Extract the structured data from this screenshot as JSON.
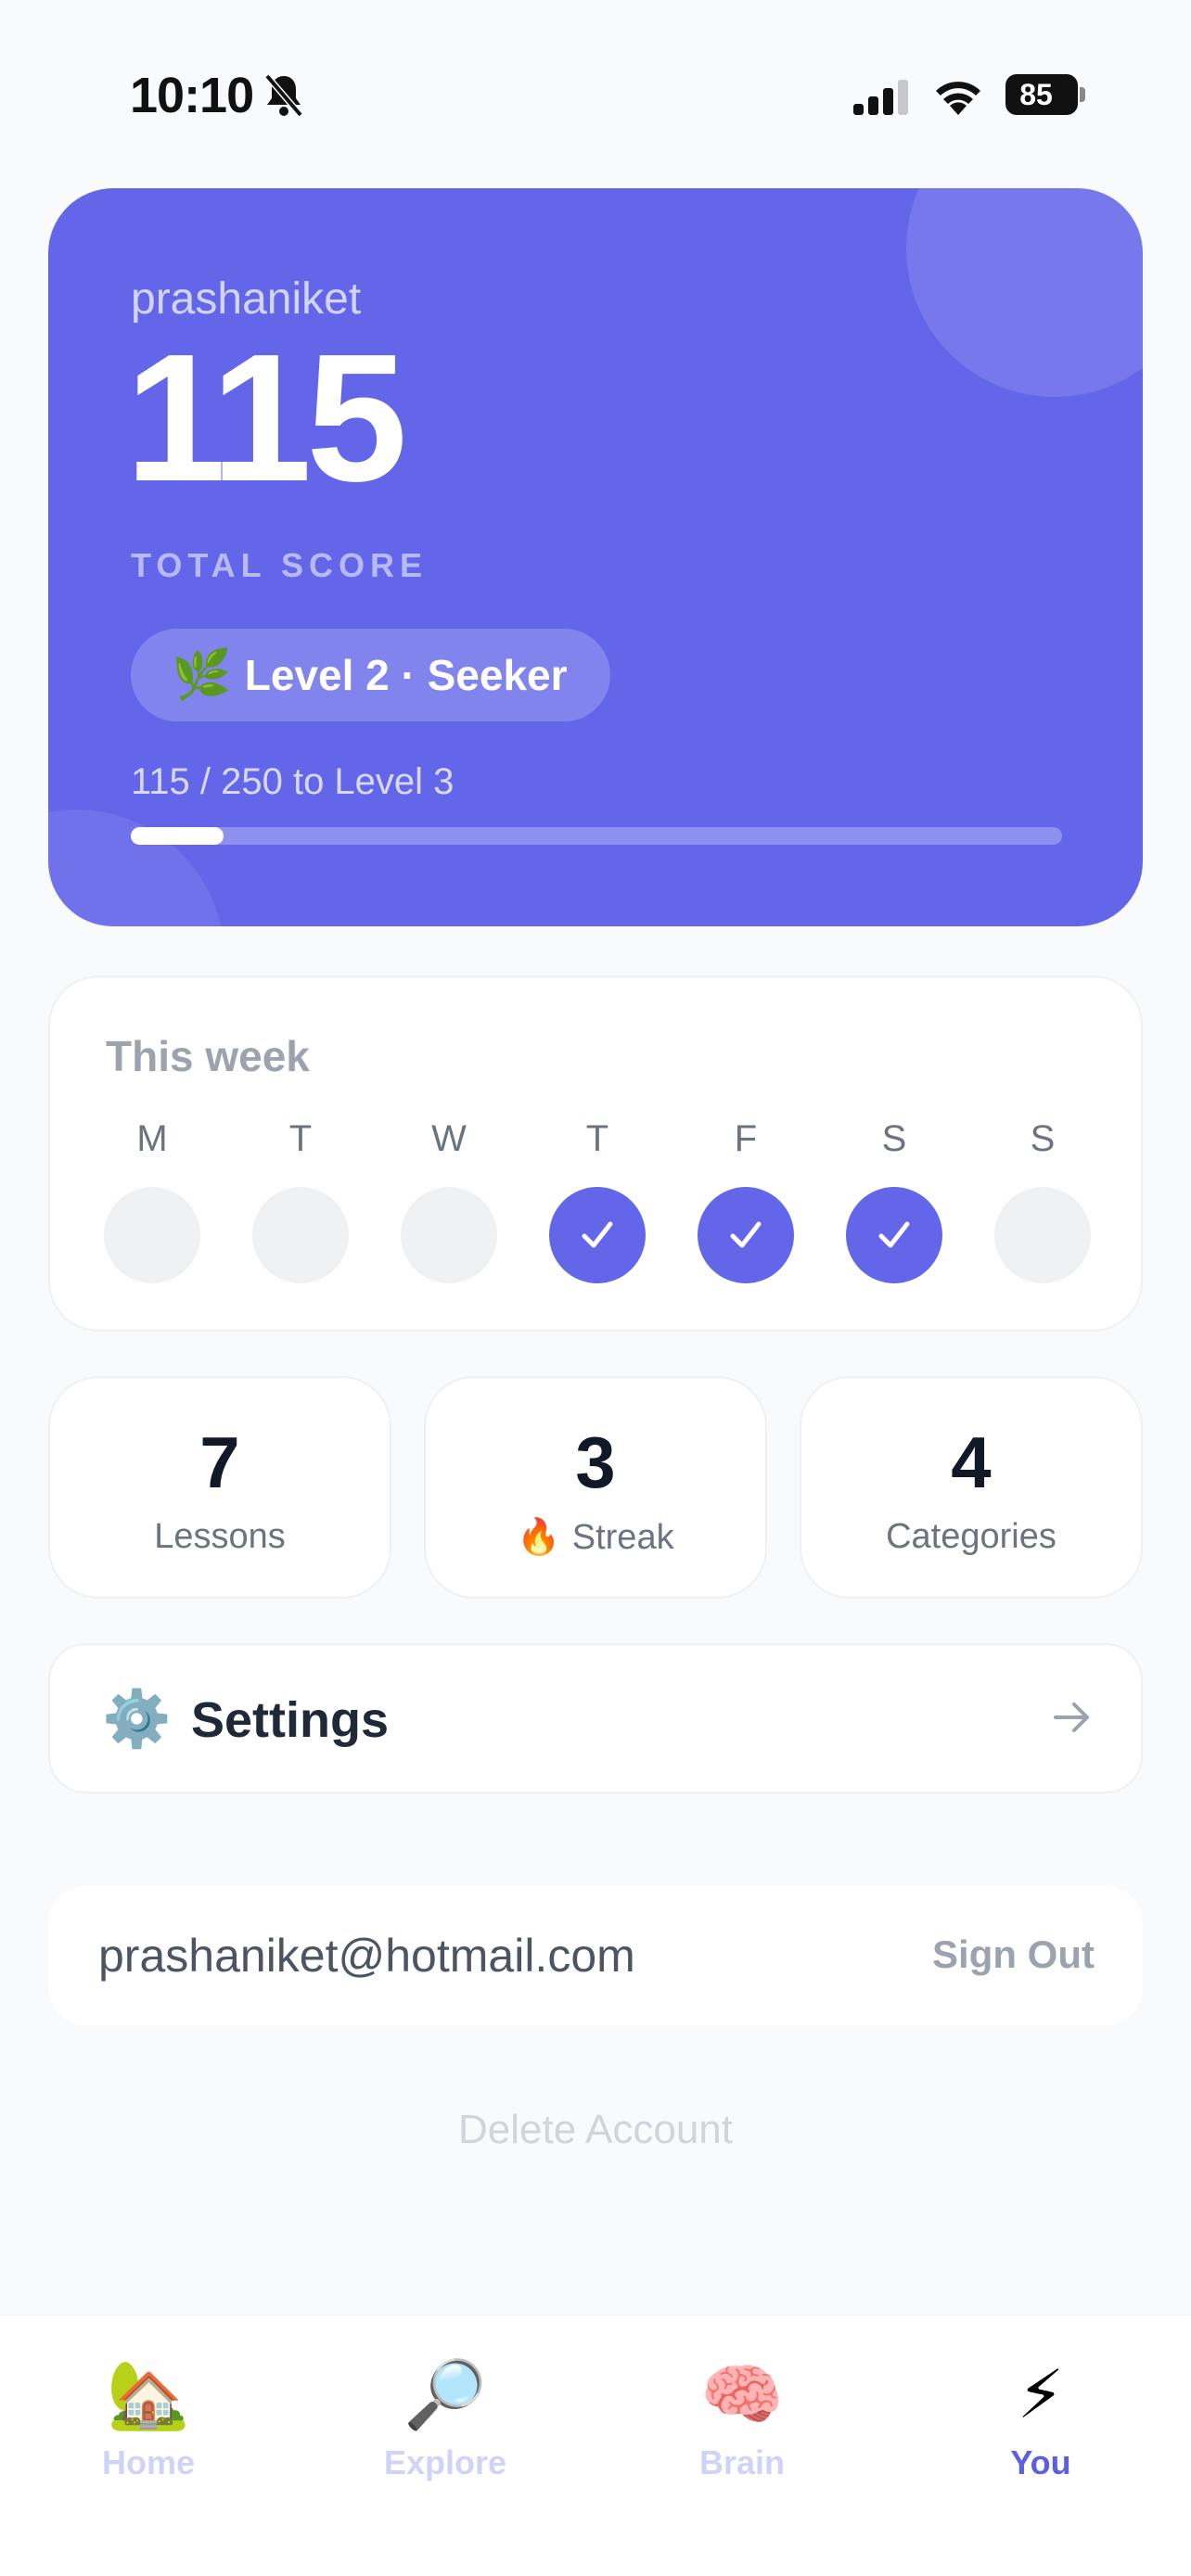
{
  "status_bar": {
    "time": "10:10",
    "battery": "85"
  },
  "profile": {
    "username": "prashaniket",
    "score": "115",
    "score_label": "TOTAL SCORE",
    "level_emoji": "🌿",
    "level_label": "Level 2 · Seeker",
    "progress_text": "115 / 250 to Level 3",
    "progress_fraction": 0.1
  },
  "week": {
    "title": "This week",
    "days": [
      {
        "letter": "M",
        "done": false
      },
      {
        "letter": "T",
        "done": false
      },
      {
        "letter": "W",
        "done": false
      },
      {
        "letter": "T",
        "done": true
      },
      {
        "letter": "F",
        "done": true
      },
      {
        "letter": "S",
        "done": true
      },
      {
        "letter": "S",
        "done": false
      }
    ]
  },
  "stats": [
    {
      "value": "7",
      "label": "Lessons",
      "emoji": ""
    },
    {
      "value": "3",
      "label": "Streak",
      "emoji": "🔥"
    },
    {
      "value": "4",
      "label": "Categories",
      "emoji": ""
    }
  ],
  "settings": {
    "emoji": "⚙️",
    "label": "Settings"
  },
  "account": {
    "email": "prashaniket@hotmail.com",
    "sign_out": "Sign Out",
    "delete": "Delete Account"
  },
  "tabs": [
    {
      "emoji": "🏡",
      "label": "Home",
      "active": false
    },
    {
      "emoji": "🔎",
      "label": "Explore",
      "active": false
    },
    {
      "emoji": "🧠",
      "label": "Brain",
      "active": false
    },
    {
      "emoji": "⚡",
      "label": "You",
      "active": true
    }
  ],
  "colors": {
    "accent": "#6366e9",
    "background": "#f9fafb"
  }
}
